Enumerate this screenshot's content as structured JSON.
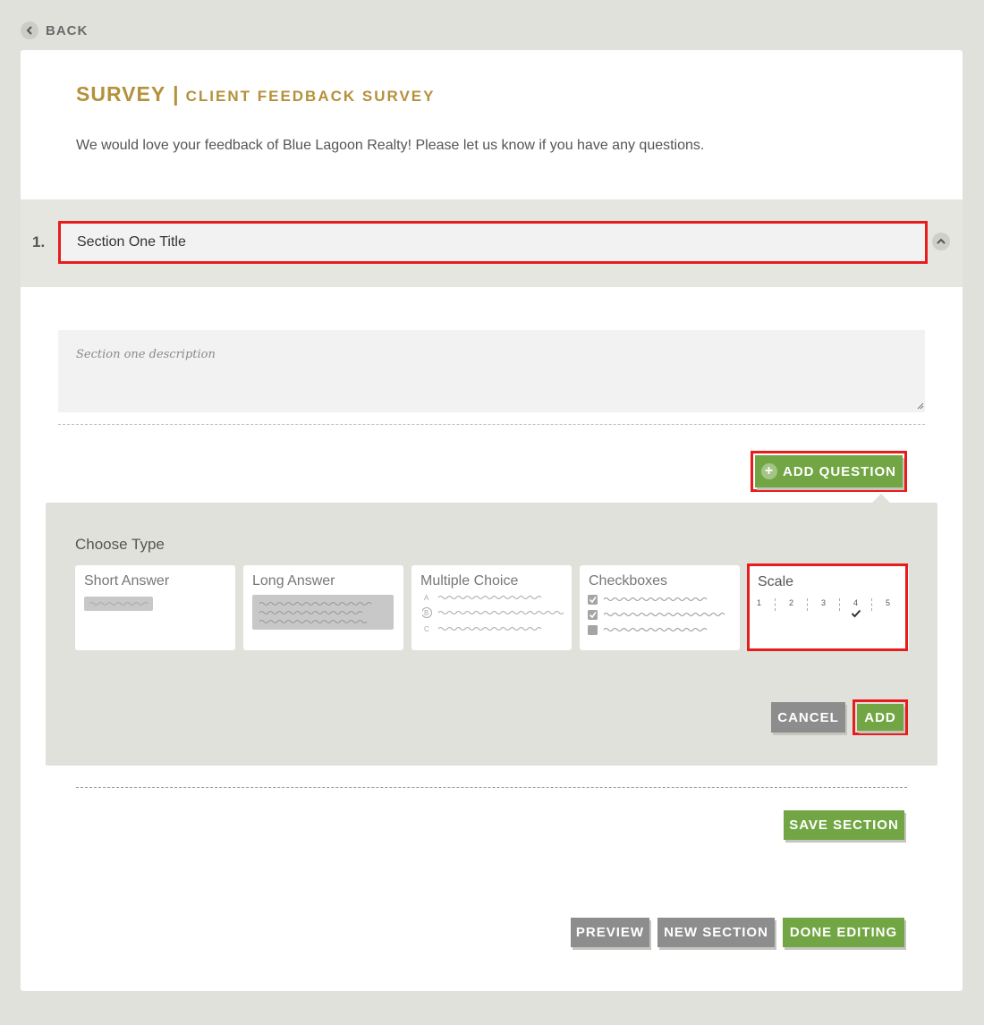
{
  "nav": {
    "back_label": "BACK"
  },
  "header": {
    "title": "SURVEY",
    "separator": "|",
    "subtitle": "CLIENT FEEDBACK SURVEY",
    "description": "We would love your feedback of Blue Lagoon Realty! Please let us know if you have any questions."
  },
  "section": {
    "number": "1.",
    "title_value": "Section One Title",
    "description_placeholder": "Section one description"
  },
  "add_question_label": "ADD QUESTION",
  "type_panel": {
    "heading": "Choose Type",
    "types": [
      {
        "label": "Short Answer"
      },
      {
        "label": "Long Answer"
      },
      {
        "label": "Multiple Choice",
        "options": [
          "A",
          "B",
          "C"
        ]
      },
      {
        "label": "Checkboxes"
      },
      {
        "label": "Scale",
        "scale": [
          "1",
          "2",
          "3",
          "4",
          "5"
        ],
        "selected": "4"
      }
    ],
    "cancel_label": "CANCEL",
    "add_label": "ADD"
  },
  "save_section_label": "SAVE SECTION",
  "footer": {
    "preview_label": "PREVIEW",
    "new_section_label": "NEW SECTION",
    "done_label": "DONE EDITING"
  },
  "colors": {
    "accent_gold": "#b4913b",
    "button_green": "#72a644",
    "button_gray": "#8d8d8d",
    "highlight_red": "#e81c1c",
    "page_bg": "#e1e1dc"
  }
}
